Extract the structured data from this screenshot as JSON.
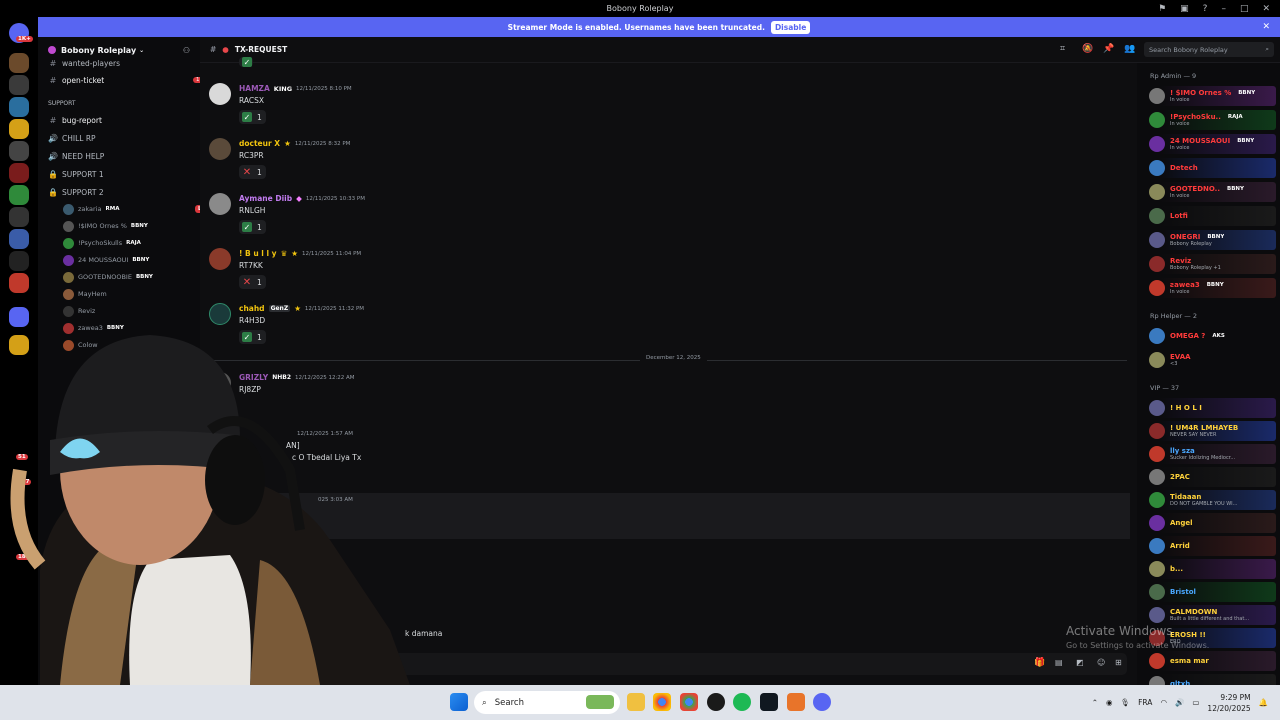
{
  "window": {
    "title": "Bobony Roleplay"
  },
  "banner": {
    "text": "Streamer Mode is enabled. Usernames have been truncated.",
    "button": "Disable"
  },
  "guild_badges": [
    "1K+",
    "51",
    "477",
    "185"
  ],
  "sidebar": {
    "server_name": "Bobony Roleplay",
    "channels": [
      {
        "icon": "#",
        "label": "wanted-players"
      },
      {
        "icon": "#",
        "label": "open-ticket",
        "badge": "1"
      },
      {
        "icon": "",
        "label": "SUPPORT"
      },
      {
        "icon": "#",
        "label": "bug-report"
      },
      {
        "icon": "🔊",
        "label": "CHILL RP"
      },
      {
        "icon": "🔊",
        "label": "NEED HELP"
      },
      {
        "icon": "🔒",
        "label": "SUPPORT 1"
      },
      {
        "icon": "🔒",
        "label": "SUPPORT 2"
      }
    ],
    "voice_users": [
      {
        "name": "zakaria",
        "tag": "RMA",
        "live": "LIVE"
      },
      {
        "name": "!$IMO Ornes %",
        "tag": "BBNY"
      },
      {
        "name": "!PsychoSkulls",
        "tag": "RAJA"
      },
      {
        "name": "24 MOUSSAOUI",
        "tag": "BBNY"
      },
      {
        "name": "GOOTEDNOOBIE",
        "tag": "BBNY"
      },
      {
        "name": "MayHem",
        "tag": ""
      },
      {
        "name": "Reviz",
        "tag": ""
      },
      {
        "name": "zawea3",
        "tag": "BBNY"
      },
      {
        "name": "Colow",
        "tag": ""
      }
    ]
  },
  "header": {
    "channel": "TX-REQUEST",
    "search_placeholder": "Search Bobony Roleplay"
  },
  "messages": [
    {
      "author": "HAMZA",
      "badge": "KING",
      "time": "12/11/2025 8:10 PM",
      "body": "RACSX",
      "reaction": "✅",
      "count": "1",
      "color": "#9b59b6"
    },
    {
      "author": "docteur X",
      "badge": "",
      "time": "12/11/2025 8:32 PM",
      "body": "RC3PR",
      "reaction": "❌",
      "count": "1",
      "color": "#f1c40f"
    },
    {
      "author": "Aymane Diib",
      "badge": "",
      "time": "12/11/2025 10:33 PM",
      "body": "RNLGH",
      "reaction": "✅",
      "count": "1",
      "color": "#c27cf0"
    },
    {
      "author": "! B u l l y",
      "badge": "",
      "time": "12/11/2025 11:04 PM",
      "body": "RT7KK",
      "reaction": "❌",
      "count": "1",
      "color": "#f1c40f"
    },
    {
      "author": "chahd",
      "badge": "GenZ",
      "time": "12/11/2025 11:32 PM",
      "body": "R4H3D",
      "reaction": "✅",
      "count": "1",
      "color": "#f1c40f"
    },
    {
      "author": "GRIZLY",
      "badge": "NHB2",
      "time": "12/12/2025 12:22 AM",
      "body": "RJ8ZP",
      "reaction": "✅",
      "count": "1",
      "color": "#9b59b6"
    }
  ],
  "date_divider": "December 12, 2025",
  "partial": {
    "time1": "12/12/2025 1:57 AM",
    "line1": "AN]",
    "line2": "c O Tbedal Liya Tx",
    "time2": "025 3:03 AM",
    "composer_text": "k damana"
  },
  "members": {
    "groups": [
      {
        "title": "Rp Admin — 9",
        "items": [
          {
            "name": "! $IMO Ornes %",
            "tag": "BBNY",
            "sub": "In voice",
            "color": "#ff3b3b"
          },
          {
            "name": "!PsychoSku..",
            "tag": "RAJA",
            "sub": "In voice",
            "color": "#ff3b3b"
          },
          {
            "name": "24 MOUSSAOUI",
            "tag": "BBNY",
            "sub": "In voice",
            "color": "#ff3b3b"
          },
          {
            "name": "Detech",
            "tag": "",
            "sub": "",
            "color": "#ff3b3b"
          },
          {
            "name": "GOOTEDNO..",
            "tag": "BBNY",
            "sub": "In voice",
            "color": "#ff3b3b"
          },
          {
            "name": "Lotfi",
            "tag": "",
            "sub": "",
            "color": "#ff3b3b"
          },
          {
            "name": "ONEGRI",
            "tag": "BBNY",
            "sub": "Bobony Roleplay",
            "color": "#ff3b3b"
          },
          {
            "name": "Reviz",
            "tag": "",
            "sub": "Bobony Roleplay +1",
            "color": "#ff3b3b"
          },
          {
            "name": "ƨawea3",
            "tag": "BBNY",
            "sub": "In voice",
            "color": "#ff3b3b"
          }
        ]
      },
      {
        "title": "Rp Helper — 2",
        "items": [
          {
            "name": "OMEGA ?",
            "tag": "AKS",
            "sub": "",
            "color": "#ff3b3b"
          },
          {
            "name": "EVAA",
            "tag": "",
            "sub": "<3",
            "color": "#ff3b3b"
          }
        ]
      },
      {
        "title": "VIP — 37",
        "items": [
          {
            "name": "! H O L I",
            "tag": "",
            "sub": "",
            "color": "#ffd23b"
          },
          {
            "name": "! UM4R LMHAYEB",
            "tag": "",
            "sub": "NEVER SAY NEVER",
            "color": "#ffd23b"
          },
          {
            "name": "lly sza",
            "tag": "",
            "sub": "Sucker Idolizing Mediocr...",
            "color": "#4aa8ff"
          },
          {
            "name": "2PAC",
            "tag": "",
            "sub": "",
            "color": "#ffd23b"
          },
          {
            "name": "Tidaaan",
            "tag": "",
            "sub": "DO NOT GAMBLE YOU WI...",
            "color": "#ffd23b"
          },
          {
            "name": "Angel",
            "tag": "",
            "sub": "",
            "color": "#ffd23b"
          },
          {
            "name": "Arrid",
            "tag": "",
            "sub": "",
            "color": "#ffd23b"
          },
          {
            "name": "b...",
            "tag": "",
            "sub": "",
            "color": "#ffd23b"
          },
          {
            "name": "Bristol",
            "tag": "",
            "sub": "",
            "color": "#4aa8ff"
          },
          {
            "name": "CALMDOWN",
            "tag": "",
            "sub": "Built a little different and that...",
            "color": "#ffd23b"
          },
          {
            "name": "EROSH !!",
            "tag": "",
            "sub": "ERO",
            "color": "#ffd23b"
          },
          {
            "name": "esma mar",
            "tag": "",
            "sub": "",
            "color": "#ffd23b"
          },
          {
            "name": "gltxh",
            "tag": "",
            "sub": "",
            "color": "#4aa8ff"
          }
        ]
      }
    ]
  },
  "watermark": {
    "line1": "Activate Windows",
    "line2": "Go to Settings to activate Windows."
  },
  "taskbar": {
    "search": "Search",
    "lang": "FRA",
    "time": "9:29 PM",
    "date": "12/20/2025"
  }
}
